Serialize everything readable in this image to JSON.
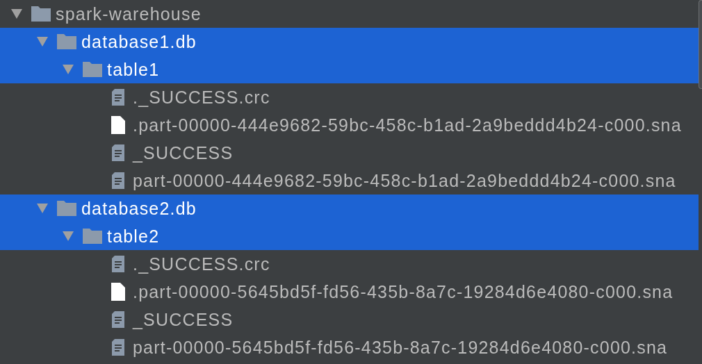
{
  "tree": [
    {
      "kind": "folder",
      "name": "spark-warehouse",
      "expanded": true,
      "selected": false,
      "children": [
        {
          "kind": "folder",
          "name": "database1.db",
          "expanded": true,
          "selected": true,
          "children": [
            {
              "kind": "folder",
              "name": "table1",
              "expanded": true,
              "selected": true,
              "children": [
                {
                  "kind": "text",
                  "name": "._SUCCESS.crc",
                  "selected": false
                },
                {
                  "kind": "blank",
                  "name": ".part-00000-444e9682-59bc-458c-b1ad-2a9beddd4b24-c000.sna",
                  "selected": false
                },
                {
                  "kind": "text",
                  "name": "_SUCCESS",
                  "selected": false
                },
                {
                  "kind": "text",
                  "name": "part-00000-444e9682-59bc-458c-b1ad-2a9beddd4b24-c000.sna",
                  "selected": false
                }
              ]
            }
          ]
        },
        {
          "kind": "folder",
          "name": "database2.db",
          "expanded": true,
          "selected": true,
          "children": [
            {
              "kind": "folder",
              "name": "table2",
              "expanded": true,
              "selected": true,
              "children": [
                {
                  "kind": "text",
                  "name": "._SUCCESS.crc",
                  "selected": false
                },
                {
                  "kind": "blank",
                  "name": ".part-00000-5645bd5f-fd56-435b-8a7c-19284d6e4080-c000.sna",
                  "selected": false
                },
                {
                  "kind": "text",
                  "name": "_SUCCESS",
                  "selected": false
                },
                {
                  "kind": "text",
                  "name": "part-00000-5645bd5f-fd56-435b-8a7c-19284d6e4080-c000.sna",
                  "selected": false
                }
              ]
            }
          ]
        }
      ]
    }
  ]
}
